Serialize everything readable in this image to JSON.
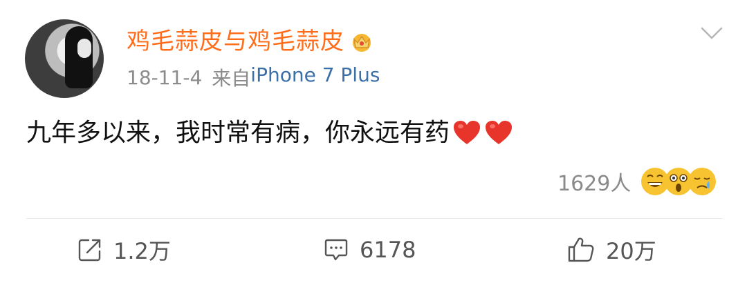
{
  "post": {
    "username": "鸡毛蒜皮与鸡毛蒜皮",
    "date": "18-11-4",
    "source_prefix": "来自",
    "source_device": "iPhone 7 Plus",
    "text": "九年多以来，我时常有病，你永远有药",
    "reactions": {
      "count_label": "1629人",
      "emojis": [
        "laughing-tears-emoji",
        "shocked-emoji",
        "crying-emoji"
      ]
    },
    "actions": {
      "repost": "1.2万",
      "comment": "6178",
      "like": "20万"
    }
  },
  "icons": {
    "crown": "crown-icon",
    "chevron": "chevron-down-icon",
    "heart": "heart-icon",
    "repost": "repost-icon",
    "comment": "comment-icon",
    "like": "like-icon"
  },
  "colors": {
    "username": "#ff6d1b",
    "device_link": "#3b6fa8",
    "meta": "#8c8c8c",
    "heart": "#e8352b"
  }
}
